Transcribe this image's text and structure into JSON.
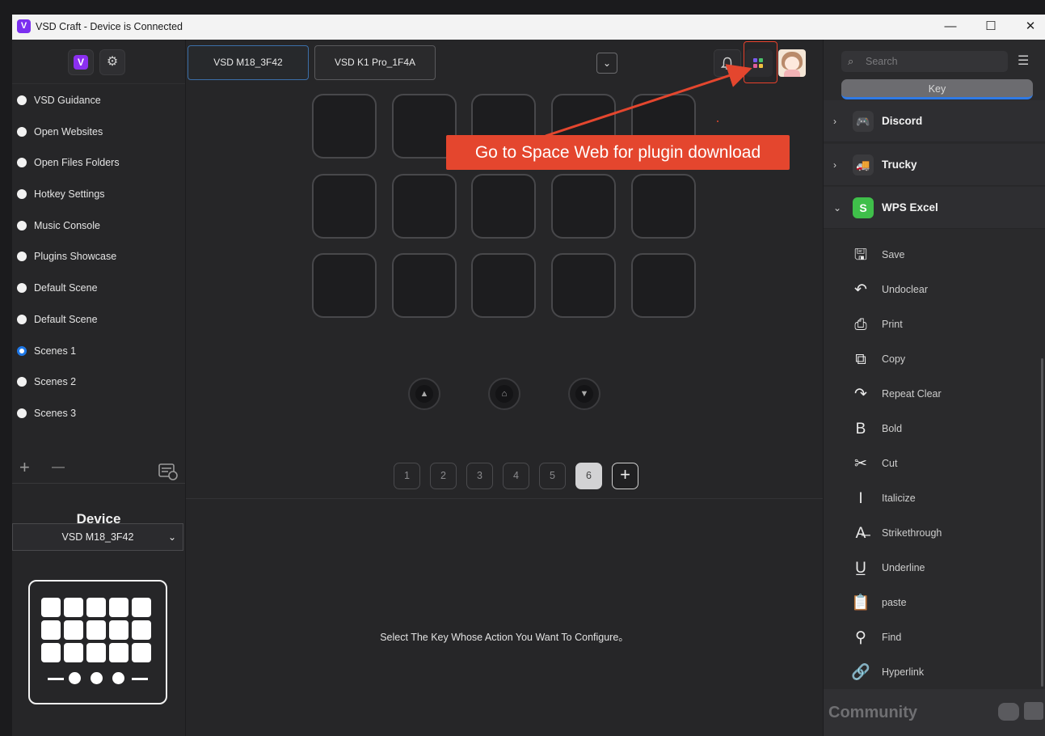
{
  "window": {
    "title": "VSD Craft - Device is Connected",
    "minimize": "—",
    "maximize": "☐",
    "close": "✕"
  },
  "sidebar": {
    "logo": "V",
    "settings_icon": "⚙",
    "scenes": [
      {
        "label": "VSD Guidance",
        "selected": false
      },
      {
        "label": "Open Websites",
        "selected": false
      },
      {
        "label": "Open Files Folders",
        "selected": false
      },
      {
        "label": "Hotkey Settings",
        "selected": false
      },
      {
        "label": "Music Console",
        "selected": false
      },
      {
        "label": "Plugins Showcase",
        "selected": false
      },
      {
        "label": "Default Scene",
        "selected": false
      },
      {
        "label": "Default Scene",
        "selected": false
      },
      {
        "label": "Scenes 1",
        "selected": true
      },
      {
        "label": "Scenes 2",
        "selected": false
      },
      {
        "label": "Scenes 3",
        "selected": false
      }
    ],
    "add": "+",
    "remove": "—",
    "device_label": "Device",
    "device_value": "VSD M18_3F42",
    "device_chevron": "⌄"
  },
  "center": {
    "device_tabs": [
      {
        "label": "VSD M18_3F42",
        "active": true
      },
      {
        "label": "VSD K1 Pro_1F4A",
        "active": false
      }
    ],
    "dropdown": "⌄",
    "bell": "🔔",
    "nav_icons": {
      "up": "▲",
      "home": "⌂",
      "down": "▼"
    },
    "pages": [
      "1",
      "2",
      "3",
      "4",
      "5",
      "6"
    ],
    "active_page": "6",
    "add_page": "+",
    "hint": "Select The Key Whose Action You Want To Configure。",
    "callout": "Go to Space Web for plugin download"
  },
  "right": {
    "search_placeholder": "Search",
    "search_icon": "⌕",
    "list_icon": "☰",
    "key_tab": "Key",
    "categories": [
      {
        "label": "Discord",
        "chevron": "›",
        "icon": "🎮",
        "icon_color": "#3a3a3d",
        "expanded": false
      },
      {
        "label": "Trucky",
        "chevron": "›",
        "icon": "🚚",
        "icon_color": "#3a3a3d",
        "expanded": false
      },
      {
        "label": "WPS Excel",
        "chevron": "⌄",
        "icon": "S",
        "icon_color": "#3fbf4a",
        "expanded": true
      }
    ],
    "actions": [
      {
        "label": "Save",
        "icon": "🖫"
      },
      {
        "label": "Undoclear",
        "icon": "↶"
      },
      {
        "label": "Print",
        "icon": "⎙"
      },
      {
        "label": "Copy",
        "icon": "⧉"
      },
      {
        "label": "Repeat Clear",
        "icon": "↷"
      },
      {
        "label": "Bold",
        "icon": "B"
      },
      {
        "label": "Cut",
        "icon": "✂"
      },
      {
        "label": "Italicize",
        "icon": "I"
      },
      {
        "label": "Strikethrough",
        "icon": "A̶"
      },
      {
        "label": "Underline",
        "icon": "U̲"
      },
      {
        "label": "paste",
        "icon": "📋"
      },
      {
        "label": "Find",
        "icon": "⚲"
      },
      {
        "label": "Hyperlink",
        "icon": "🔗"
      }
    ],
    "community": "Community"
  },
  "colors": {
    "accent": "#2f7ae5",
    "callout": "#e4462e",
    "selected_radio": "#1e77e6"
  }
}
